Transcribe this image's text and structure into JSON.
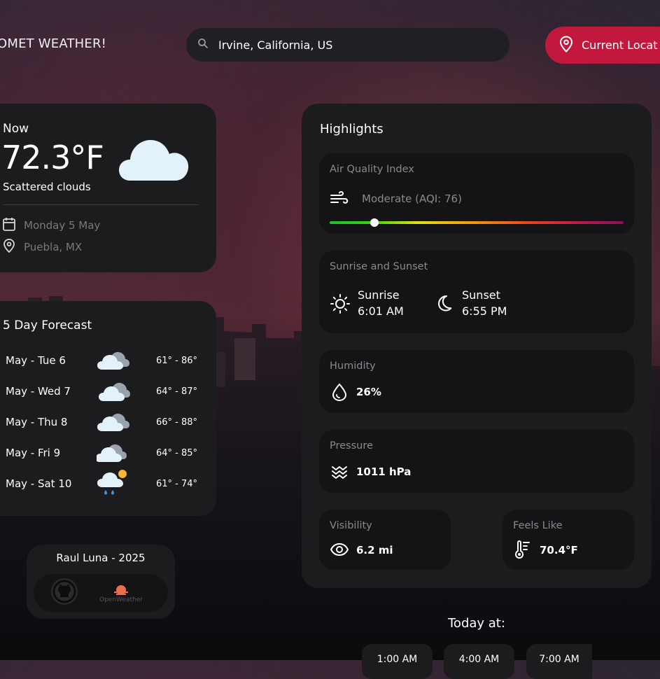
{
  "header": {
    "brand": "OMET WEATHER!",
    "search_value": "Irvine, California, US",
    "current_location_label": "Current Locat"
  },
  "now": {
    "label": "Now",
    "temperature": "72.3°F",
    "condition": "Scattered clouds",
    "date": "Monday 5 May",
    "location": "Puebla, MX"
  },
  "forecast": {
    "title": "5 Day Forecast",
    "days": [
      {
        "day": "May - Tue 6",
        "range": "61° - 86°",
        "icon": "broken-clouds-icon"
      },
      {
        "day": "May - Wed 7",
        "range": "64° - 87°",
        "icon": "broken-clouds-icon"
      },
      {
        "day": "May - Thu 8",
        "range": "66° - 88°",
        "icon": "broken-clouds-icon"
      },
      {
        "day": "May - Fri 9",
        "range": "64° - 85°",
        "icon": "broken-clouds-icon"
      },
      {
        "day": "May - Sat 10",
        "range": "61° - 74°",
        "icon": "rain-icon"
      }
    ]
  },
  "credits": {
    "title": "Raul Luna - 2025",
    "openweather": "OpenWeather"
  },
  "highlights": {
    "title": "Highlights",
    "aqi": {
      "title": "Air Quality Index",
      "value": "Moderate (AQI: 76)",
      "level": 76
    },
    "sun": {
      "title": "Sunrise and Sunset",
      "sunrise_label": "Sunrise",
      "sunrise_time": "6:01 AM",
      "sunset_label": "Sunset",
      "sunset_time": "6:55 PM"
    },
    "humidity": {
      "title": "Humidity",
      "value": "26%"
    },
    "pressure": {
      "title": "Pressure",
      "value": "1011 hPa"
    },
    "visibility": {
      "title": "Visibility",
      "value": "6.2 mi"
    },
    "feels_like": {
      "title": "Feels Like",
      "value": "70.4°F"
    }
  },
  "today": {
    "title": "Today at:",
    "hours": [
      "1:00 AM",
      "4:00 AM",
      "7:00 AM"
    ]
  },
  "colors": {
    "accent": "#c3183d",
    "card": "#1c1c1e",
    "subcard": "#141416"
  }
}
